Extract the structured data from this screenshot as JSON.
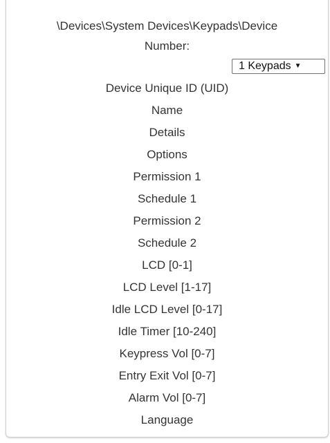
{
  "path": "\\Devices\\System Devices\\Keypads\\Device",
  "number_label": "Number:",
  "number_select": {
    "value": "1 Keypads",
    "arrow": "▼"
  },
  "fields": [
    "Device Unique ID (UID)",
    "Name",
    "Details",
    "Options",
    "Permission 1",
    "Schedule 1",
    "Permission 2",
    "Schedule 2",
    "LCD [0-1]",
    "LCD Level [1-17]",
    "Idle LCD Level [0-17]",
    "Idle Timer [10-240]",
    "Keypress Vol [0-7]",
    "Entry Exit Vol [0-7]",
    "Alarm Vol [0-7]",
    "Language"
  ]
}
